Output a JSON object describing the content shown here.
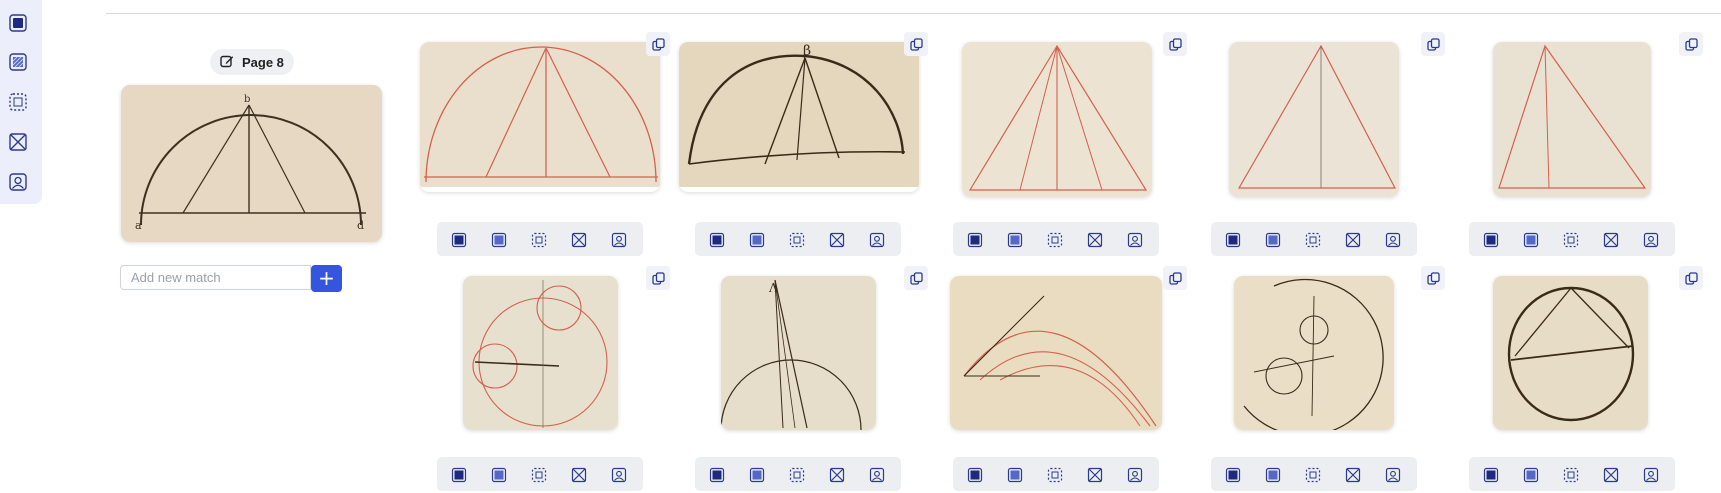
{
  "toolbar": {
    "items": [
      {
        "name": "filled-square-icon"
      },
      {
        "name": "hatched-square-icon"
      },
      {
        "name": "dashed-square-icon"
      },
      {
        "name": "crossed-square-icon"
      },
      {
        "name": "person-square-icon"
      }
    ]
  },
  "query": {
    "page_label": "Page 8",
    "add_placeholder": "Add new match",
    "add_button": "+"
  },
  "matches": {
    "count": 10,
    "actions": [
      "filled-square-icon",
      "hatched-square-icon",
      "dashed-square-icon",
      "crossed-square-icon",
      "person-square-icon"
    ]
  },
  "colors": {
    "accent": "#3554e0",
    "toolbar_bg": "#eceefb",
    "icon_navy": "#2b3a8f",
    "parchment": "#e8dcc6",
    "red_ink": "#d46a5a",
    "brown_ink": "#4a3a28"
  }
}
